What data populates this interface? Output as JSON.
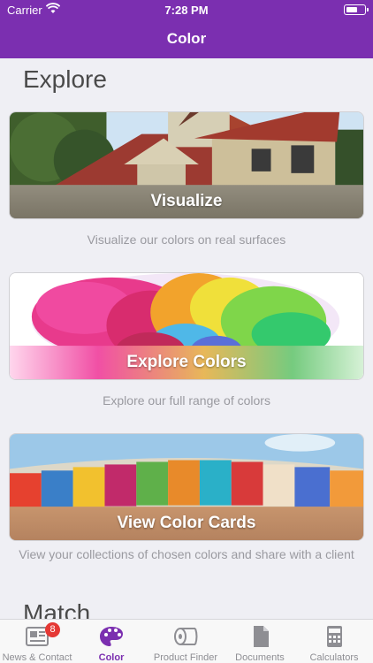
{
  "status_bar": {
    "carrier": "Carrier",
    "time": "7:28 PM"
  },
  "nav": {
    "title": "Color"
  },
  "explore": {
    "heading": "Explore",
    "cards": [
      {
        "label": "Visualize",
        "caption": "Visualize our colors on real surfaces"
      },
      {
        "label": "Explore Colors",
        "caption": "Explore our full range of colors"
      },
      {
        "label": "View Color Cards",
        "caption": "View your collections of chosen colors and share with a client"
      }
    ]
  },
  "match": {
    "heading": "Match"
  },
  "tabbar": {
    "tabs": [
      {
        "label": "News & Contact",
        "icon": "newspaper-icon",
        "badge": "8"
      },
      {
        "label": "Color",
        "icon": "palette-icon",
        "active": true
      },
      {
        "label": "Product Finder",
        "icon": "coil-icon"
      },
      {
        "label": "Documents",
        "icon": "document-icon"
      },
      {
        "label": "Calculators",
        "icon": "calculator-icon"
      }
    ]
  },
  "colors": {
    "brand": "#7b2fb0",
    "background": "#efeff4",
    "caption": "#9a9aa0",
    "badge": "#e53935"
  }
}
